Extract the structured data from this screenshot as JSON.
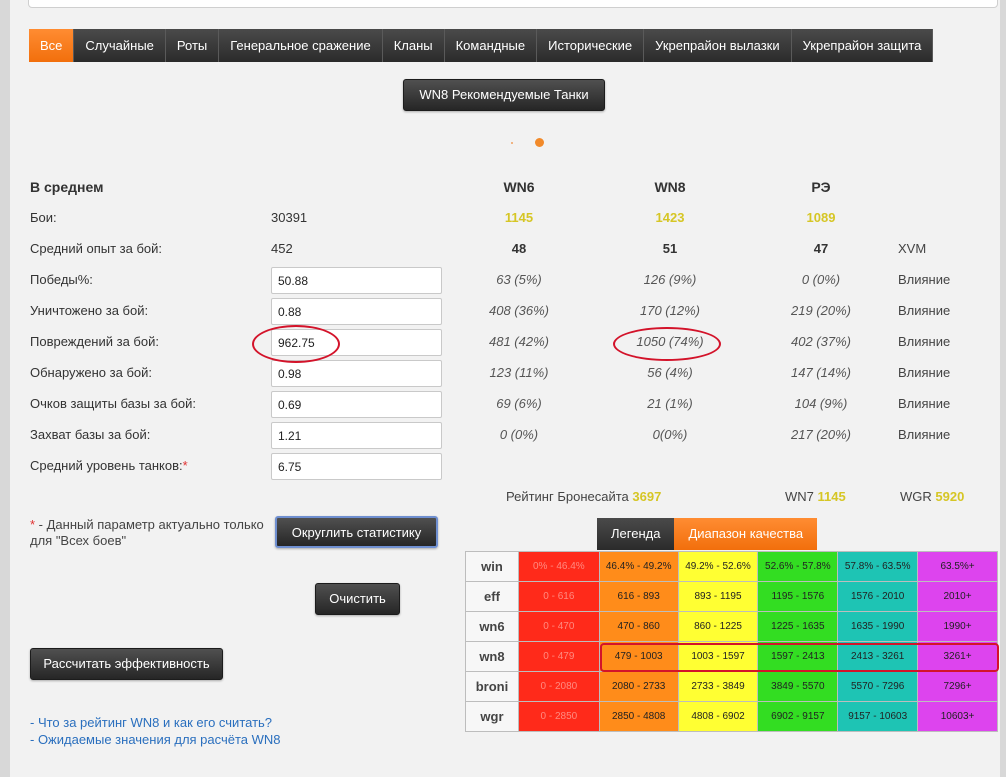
{
  "tabs": [
    "Все",
    "Случайные",
    "Роты",
    "Генеральное сражение",
    "Кланы",
    "Командные",
    "Исторические",
    "Укрепрайон вылазки",
    "Укрепрайон защита"
  ],
  "recommended_button": "WN8 Рекомендуемые Танки",
  "stats": {
    "heading": "В среднем",
    "col_wn6": "WN6",
    "col_wn8": "WN8",
    "col_re": "РЭ",
    "rows": [
      {
        "label": "Бои:",
        "value": "30391",
        "wn6": "1145",
        "wn8": "1423",
        "re": "1089",
        "extra": ""
      },
      {
        "label": "Средний опыт за бой:",
        "value": "452",
        "wn6": "48",
        "wn8": "51",
        "re": "47",
        "extra": "XVM"
      },
      {
        "label": "Победы%:",
        "value": "50.88",
        "wn6": "63 (5%)",
        "wn8": "126 (9%)",
        "re": "0 (0%)",
        "extra": "Влияние"
      },
      {
        "label": "Уничтожено за бой:",
        "value": "0.88",
        "wn6": "408 (36%)",
        "wn8": "170 (12%)",
        "re": "219 (20%)",
        "extra": "Влияние"
      },
      {
        "label": "Повреждений за бой:",
        "value": "962.75",
        "wn6": "481 (42%)",
        "wn8": "1050 (74%)",
        "re": "402 (37%)",
        "extra": "Влияние"
      },
      {
        "label": "Обнаружено за бой:",
        "value": "0.98",
        "wn6": "123 (11%)",
        "wn8": "56 (4%)",
        "re": "147 (14%)",
        "extra": "Влияние"
      },
      {
        "label": "Очков защиты базы за бой:",
        "value": "0.69",
        "wn6": "69 (6%)",
        "wn8": "21 (1%)",
        "re": "104 (9%)",
        "extra": "Влияние"
      },
      {
        "label": "Захват базы за бой:",
        "value": "1.21",
        "wn6": "0 (0%)",
        "wn8": "0(0%)",
        "re": "217 (20%)",
        "extra": "Влияние"
      },
      {
        "label": "Средний уровень танков:",
        "value": "6.75",
        "wn6": "",
        "wn8": "",
        "re": "",
        "extra": ""
      }
    ],
    "level_star": "*"
  },
  "ratings": {
    "bronesite_label": "Рейтинг Бронесайта",
    "bronesite_value": "3697",
    "wn7_label": "WN7",
    "wn7_value": "1145",
    "wgr_label": "WGR",
    "wgr_value": "5920"
  },
  "note": {
    "star": "*",
    "text": " - Данный параметр актуально только для \"Всех боев\""
  },
  "buttons": {
    "round": "Округлить статистику",
    "clear": "Очистить",
    "calc": "Рассчитать эффективность"
  },
  "legend_tabs": [
    "Легенда",
    "Диапазон качества"
  ],
  "quality_table": [
    {
      "name": "win",
      "cells": [
        "0% - 46.4%",
        "46.4% - 49.2%",
        "49.2% - 52.6%",
        "52.6% - 57.8%",
        "57.8% - 63.5%",
        "63.5%+"
      ]
    },
    {
      "name": "eff",
      "cells": [
        "0 - 616",
        "616 - 893",
        "893 - 1195",
        "1195 - 1576",
        "1576 - 2010",
        "2010+"
      ]
    },
    {
      "name": "wn6",
      "cells": [
        "0 - 470",
        "470 - 860",
        "860 - 1225",
        "1225 - 1635",
        "1635 - 1990",
        "1990+"
      ]
    },
    {
      "name": "wn8",
      "cells": [
        "0 - 479",
        "479 - 1003",
        "1003 - 1597",
        "1597 - 2413",
        "2413 - 3261",
        "3261+"
      ]
    },
    {
      "name": "broni",
      "cells": [
        "0 - 2080",
        "2080 - 2733",
        "2733 - 3849",
        "3849 - 5570",
        "5570 - 7296",
        "7296+"
      ]
    },
    {
      "name": "wgr",
      "cells": [
        "0 - 2850",
        "2850 - 4808",
        "4808 - 6902",
        "6902 - 9157",
        "9157 - 10603",
        "10603+"
      ]
    }
  ],
  "colors": {
    "accent": "#f26f0c",
    "rating_yellow": "#d6c625",
    "annotation_red": "#d3132a",
    "scale": [
      "#ff2a1a",
      "#ff8c1a",
      "#ffff33",
      "#33dd22",
      "#1ec4b4",
      "#dd44ee"
    ]
  },
  "links": [
    "- Что за рейтинг WN8 и как его считать?",
    "- Ожидаемые значения для расчёта WN8"
  ]
}
